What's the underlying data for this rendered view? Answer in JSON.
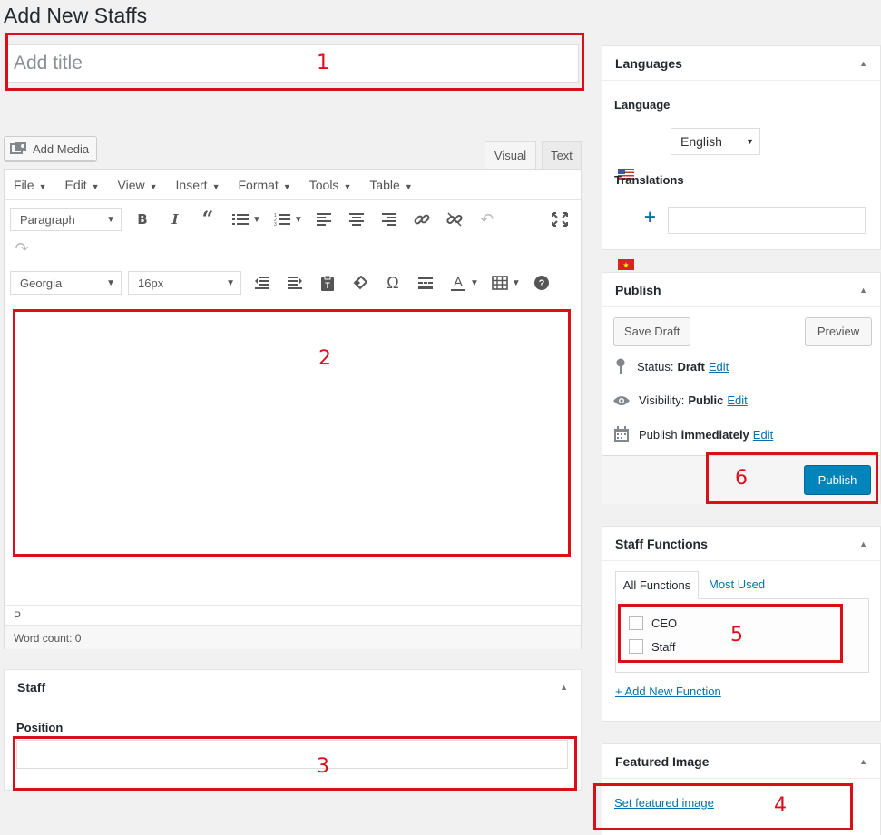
{
  "page": {
    "title": "Add New Staffs"
  },
  "title_field": {
    "placeholder": "Add title",
    "value": ""
  },
  "editor": {
    "add_media_label": "Add Media",
    "tabs": {
      "visual": "Visual",
      "text": "Text"
    },
    "menus": [
      "File",
      "Edit",
      "View",
      "Insert",
      "Format",
      "Tools",
      "Table"
    ],
    "format_select": "Paragraph",
    "font_family_select": "Georgia",
    "font_size_select": "16px",
    "path": "P",
    "word_count": "Word count: 0"
  },
  "staff_box": {
    "title": "Staff",
    "position_label": "Position",
    "position_value": ""
  },
  "languages": {
    "title": "Languages",
    "language_label": "Language",
    "language_value": "English",
    "translations_label": "Translations",
    "translation_value": ""
  },
  "publish": {
    "title": "Publish",
    "save_draft": "Save Draft",
    "preview": "Preview",
    "status_label": "Status:",
    "status_value": "Draft",
    "visibility_label": "Visibility:",
    "visibility_value": "Public",
    "publish_label": "Publish",
    "publish_value": "immediately",
    "edit": "Edit",
    "publish_button": "Publish"
  },
  "staff_functions": {
    "title": "Staff Functions",
    "tabs": [
      "All Functions",
      "Most Used"
    ],
    "items": [
      "CEO",
      "Staff"
    ],
    "add_new": "+ Add New Function"
  },
  "featured_image": {
    "title": "Featured Image",
    "link": "Set featured image"
  },
  "annotations": [
    "1",
    "2",
    "3",
    "4",
    "5",
    "6"
  ],
  "colors": {
    "annotation": "#d9101a",
    "primary_button": "#0085ba",
    "link": "#0073aa"
  }
}
